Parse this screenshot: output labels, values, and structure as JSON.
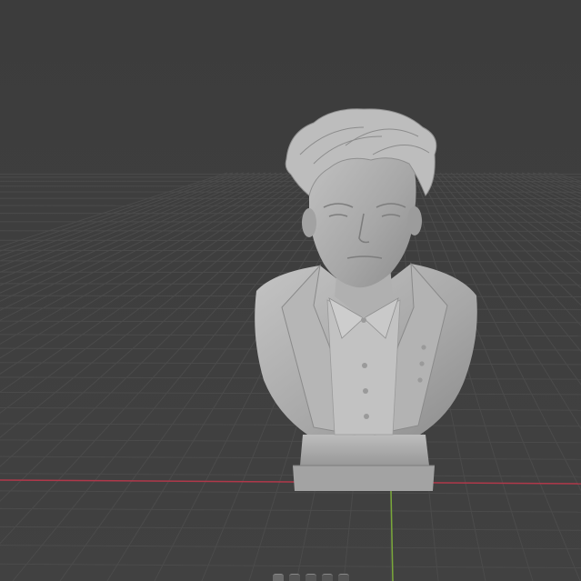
{
  "app": "3D viewport",
  "viewport": {
    "background_color": "#3d3d3d",
    "grid_line_color": "#4b4b4b",
    "x_axis_color": "#b0384a",
    "y_axis_color": "#7aa83a",
    "model_color": "#a9a9a9"
  },
  "scene_object": {
    "name": "bust-sculpture",
    "description_icon": "bust-model"
  },
  "toolbar": {
    "buttons": [
      {
        "icon": "view-icon"
      },
      {
        "icon": "pan-icon"
      },
      {
        "icon": "rotate-icon"
      },
      {
        "icon": "camera-icon"
      },
      {
        "icon": "render-icon"
      }
    ]
  }
}
